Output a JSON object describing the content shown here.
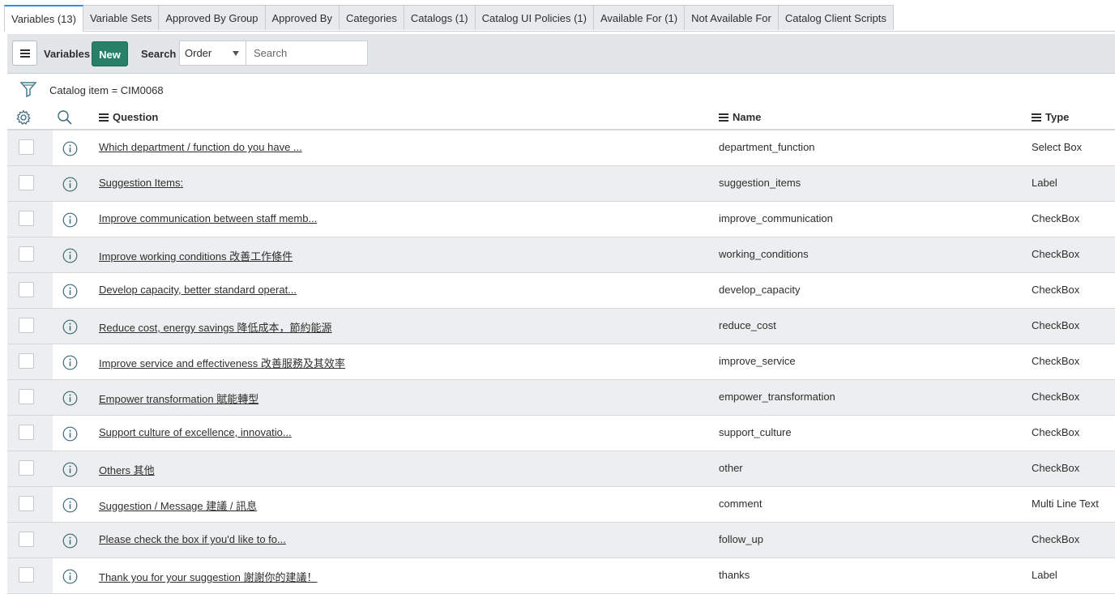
{
  "tabs": [
    {
      "label": "Variables (13)",
      "active": true
    },
    {
      "label": "Variable Sets"
    },
    {
      "label": "Approved By Group"
    },
    {
      "label": "Approved By"
    },
    {
      "label": "Categories"
    },
    {
      "label": "Catalogs (1)"
    },
    {
      "label": "Catalog UI Policies (1)"
    },
    {
      "label": "Available For (1)"
    },
    {
      "label": "Not Available For"
    },
    {
      "label": "Catalog Client Scripts"
    }
  ],
  "toolbar": {
    "title": "Variables",
    "new_label": "New",
    "search_label": "Search",
    "search_field_selected": "Order",
    "search_placeholder": "Search"
  },
  "filter": {
    "text": "Catalog item = CIM0068"
  },
  "columns": {
    "question": "Question",
    "name": "Name",
    "type": "Type"
  },
  "rows": [
    {
      "question": "Which department / function do you have ...",
      "name": "department_function",
      "type": "Select Box"
    },
    {
      "question": "Suggestion Items:",
      "name": "suggestion_items",
      "type": "Label"
    },
    {
      "question": "Improve communication between staff memb...",
      "name": "improve_communication",
      "type": "CheckBox"
    },
    {
      "question": "Improve working conditions 改善工作條件",
      "name": "working_conditions",
      "type": "CheckBox"
    },
    {
      "question": "Develop capacity, better standard operat...",
      "name": "develop_capacity",
      "type": "CheckBox"
    },
    {
      "question": "Reduce cost, energy savings 降低成本，節約能源",
      "name": "reduce_cost",
      "type": "CheckBox"
    },
    {
      "question": "Improve service and effectiveness 改善服務及其效率",
      "name": "improve_service",
      "type": "CheckBox"
    },
    {
      "question": "Empower transformation 賦能轉型",
      "name": "empower_transformation",
      "type": "CheckBox"
    },
    {
      "question": "Support culture of excellence, innovatio...",
      "name": "support_culture",
      "type": "CheckBox"
    },
    {
      "question": "Others 其他",
      "name": "other",
      "type": "CheckBox"
    },
    {
      "question": "Suggestion / Message 建議 / 訊息",
      "name": "comment",
      "type": "Multi Line Text"
    },
    {
      "question": "Please check the box if you'd like to fo...",
      "name": "follow_up",
      "type": "CheckBox"
    },
    {
      "question": "Thank you for your suggestion 謝謝你的建議！",
      "name": "thanks",
      "type": "Label"
    }
  ],
  "colors": {
    "accent_tab": "#278efc",
    "new_button": "#278067",
    "toolbar_bg": "#e3e6e8",
    "row_alt_bg": "#eceeef"
  }
}
